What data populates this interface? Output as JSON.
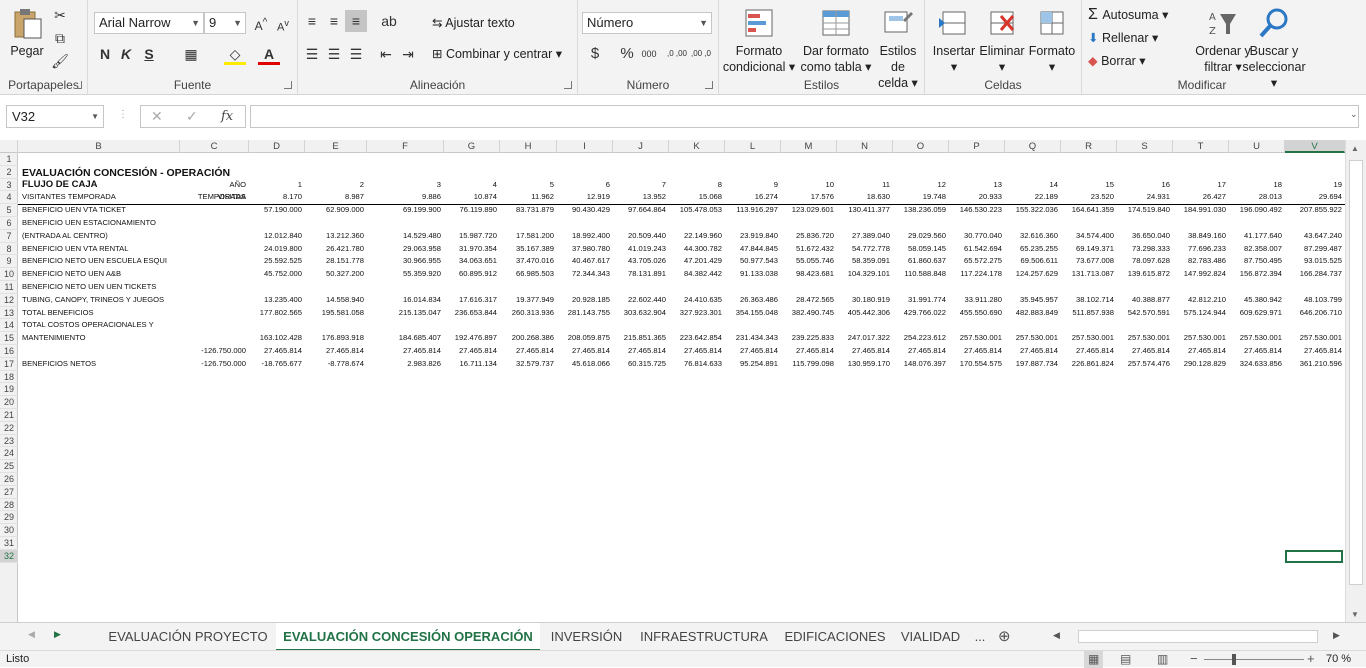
{
  "ribbon": {
    "portapapeles": {
      "label": "Portapapeles",
      "pegar": "Pegar"
    },
    "fuente": {
      "label": "Fuente",
      "font": "Arial Narrow",
      "size": "9",
      "bold": "N",
      "italic": "K",
      "underline": "S"
    },
    "alineacion": {
      "label": "Alineación",
      "wrap": "Ajustar texto",
      "merge": "Combinar y centrar"
    },
    "numero": {
      "label": "Número",
      "format": "Número",
      "currency": "$",
      "percent": "%",
      "thousands": "000",
      "dec_inc": ",0 ,00",
      "dec_dec": ",00 ,0"
    },
    "estilos": {
      "label": "Estilos",
      "cond_1": "Formato",
      "cond_2": "condicional",
      "table_1": "Dar formato",
      "table_2": "como tabla",
      "cell_1": "Estilos de",
      "cell_2": "celda"
    },
    "celdas": {
      "label": "Celdas",
      "insert": "Insertar",
      "delete": "Eliminar",
      "format": "Formato"
    },
    "modificar": {
      "label": "Modificar",
      "autosum": "Autosuma",
      "fill": "Rellenar",
      "clear": "Borrar",
      "sort_1": "Ordenar y",
      "sort_2": "filtrar",
      "find_1": "Buscar y",
      "find_2": "seleccionar"
    }
  },
  "formula_bar": {
    "name_box": "V32",
    "fx": "fx",
    "formula": ""
  },
  "columns": [
    "B",
    "C",
    "D",
    "E",
    "F",
    "G",
    "H",
    "I",
    "J",
    "K",
    "L",
    "M",
    "N",
    "O",
    "P",
    "Q",
    "R",
    "S",
    "T",
    "U",
    "V"
  ],
  "rows": [
    "1",
    "2",
    "3",
    "4",
    "5",
    "6",
    "7",
    "8",
    "9",
    "10",
    "11",
    "12",
    "13",
    "14",
    "15",
    "16",
    "17",
    "18",
    "19",
    "20",
    "21",
    "22",
    "23",
    "24",
    "25",
    "26",
    "27",
    "28",
    "29",
    "30",
    "31",
    "32"
  ],
  "sheet": {
    "title": "EVALUACIÓN CONCESIÓN - OPERACIÓN",
    "subtitle": "FLUJO DE CAJA",
    "c3": "AÑO",
    "years": [
      "1",
      "2",
      "3",
      "4",
      "5",
      "6",
      "7",
      "8",
      "9",
      "10",
      "11",
      "12",
      "13",
      "14",
      "15",
      "16",
      "17",
      "18",
      "19"
    ],
    "c_visitas_1": "VISITAS",
    "c_visitas_2": "TEMPORADA",
    "data_rows": [
      {
        "r": 4,
        "label": "VISITANTES TEMPORADA",
        "c": "",
        "values": [
          "8.170",
          "8.987",
          "9.886",
          "10.874",
          "11.962",
          "12.919",
          "13.952",
          "15.068",
          "16.274",
          "17.576",
          "18.630",
          "19.748",
          "20.933",
          "22.189",
          "23.520",
          "24.931",
          "26.427",
          "28.013",
          "29.694"
        ]
      },
      {
        "r": 5,
        "label": "BENEFICIO UEN VTA TICKET",
        "c": "",
        "values": [
          "57.190.000",
          "62.909.000",
          "69.199.900",
          "76.119.890",
          "83.731.879",
          "90.430.429",
          "97.664.864",
          "105.478.053",
          "113.916.297",
          "123.029.601",
          "130.411.377",
          "138.236.059",
          "146.530.223",
          "155.322.036",
          "164.641.359",
          "174.519.840",
          "184.991.030",
          "196.090.492",
          "207.855.922"
        ]
      },
      {
        "r": 6,
        "label": "BENEFICIO UEN ESTACIONAMIENTO",
        "c": "",
        "values": []
      },
      {
        "r": 7,
        "label": "(ENTRADA AL CENTRO)",
        "c": "",
        "values": [
          "12.012.840",
          "13.212.360",
          "14.529.480",
          "15.987.720",
          "17.581.200",
          "18.992.400",
          "20.509.440",
          "22.149.960",
          "23.919.840",
          "25.836.720",
          "27.389.040",
          "29.029.560",
          "30.770.040",
          "32.616.360",
          "34.574.400",
          "36.650.040",
          "38.849.160",
          "41.177.640",
          "43.647.240"
        ]
      },
      {
        "r": 8,
        "label": "BENEFICIO UEN VTA RENTAL",
        "c": "",
        "values": [
          "24.019.800",
          "26.421.780",
          "29.063.958",
          "31.970.354",
          "35.167.389",
          "37.980.780",
          "41.019.243",
          "44.300.782",
          "47.844.845",
          "51.672.432",
          "54.772.778",
          "58.059.145",
          "61.542.694",
          "65.235.255",
          "69.149.371",
          "73.298.333",
          "77.696.233",
          "82.358.007",
          "87.299.487"
        ]
      },
      {
        "r": 9,
        "label": "BENEFICIO NETO UEN ESCUELA ESQUI",
        "c": "",
        "values": [
          "25.592.525",
          "28.151.778",
          "30.966.955",
          "34.063.651",
          "37.470.016",
          "40.467.617",
          "43.705.026",
          "47.201.429",
          "50.977.543",
          "55.055.746",
          "58.359.091",
          "61.860.637",
          "65.572.275",
          "69.506.611",
          "73.677.008",
          "78.097.628",
          "82.783.486",
          "87.750.495",
          "93.015.525"
        ]
      },
      {
        "r": 10,
        "label": "BENEFICIO NETO UEN A&B",
        "c": "",
        "values": [
          "45.752.000",
          "50.327.200",
          "55.359.920",
          "60.895.912",
          "66.985.503",
          "72.344.343",
          "78.131.891",
          "84.382.442",
          "91.133.038",
          "98.423.681",
          "104.329.101",
          "110.588.848",
          "117.224.178",
          "124.257.629",
          "131.713.087",
          "139.615.872",
          "147.992.824",
          "156.872.394",
          "166.284.737"
        ]
      },
      {
        "r": 11,
        "label": "BENEFICIO NETO UEN UEN TICKETS",
        "c": "",
        "values": []
      },
      {
        "r": 12,
        "label": "TUBING, CANOPY, TRINEOS Y JUEGOS",
        "c": "",
        "values": [
          "13.235.400",
          "14.558.940",
          "16.014.834",
          "17.616.317",
          "19.377.949",
          "20.928.185",
          "22.602.440",
          "24.410.635",
          "26.363.486",
          "28.472.565",
          "30.180.919",
          "31.991.774",
          "33.911.280",
          "35.945.957",
          "38.102.714",
          "40.388.877",
          "42.812.210",
          "45.380.942",
          "48.103.799"
        ]
      },
      {
        "r": 13,
        "label": "TOTAL BENEFICIOS",
        "c": "",
        "values": [
          "177.802.565",
          "195.581.058",
          "215.135.047",
          "236.653.844",
          "260.313.936",
          "281.143.755",
          "303.632.904",
          "327.923.301",
          "354.155.048",
          "382.490.745",
          "405.442.306",
          "429.766.022",
          "455.550.690",
          "482.883.849",
          "511.857.938",
          "542.570.591",
          "575.124.944",
          "609.629.971",
          "646.206.710"
        ]
      },
      {
        "r": 15,
        "label": "TOTAL COSTOS OPERACIONALES Y",
        "c": "",
        "values": []
      },
      {
        "r": 16,
        "label": "MANTENIMIENTO",
        "c": "",
        "values": [
          "163.102.428",
          "176.893.918",
          "184.685.407",
          "192.476.897",
          "200.268.386",
          "208.059.875",
          "215.851.365",
          "223.642.854",
          "231.434.343",
          "239.225.833",
          "247.017.322",
          "254.223.612",
          "257.530.001",
          "257.530.001",
          "257.530.001",
          "257.530.001",
          "257.530.001",
          "257.530.001",
          "257.530.001"
        ]
      },
      {
        "r": 17,
        "label": "",
        "c": "-126.750.000",
        "values": [
          "27.465.814",
          "27.465.814",
          "27.465.814",
          "27.465.814",
          "27.465.814",
          "27.465.814",
          "27.465.814",
          "27.465.814",
          "27.465.814",
          "27.465.814",
          "27.465.814",
          "27.465.814",
          "27.465.814",
          "27.465.814",
          "27.465.814",
          "27.465.814",
          "27.465.814",
          "27.465.814",
          "27.465.814"
        ]
      },
      {
        "r": 18,
        "label": "BENEFICIOS NETOS",
        "c": "-126.750.000",
        "values": [
          "-18.765.677",
          "-8.778.674",
          "2.983.826",
          "16.711.134",
          "32.579.737",
          "45.618.066",
          "60.315.725",
          "76.814.633",
          "95.254.891",
          "115.799.098",
          "130.959.170",
          "148.076.397",
          "170.554.575",
          "197.887.734",
          "226.861.824",
          "257.574.476",
          "290.128.829",
          "324.633.856",
          "361.210.596"
        ]
      }
    ]
  },
  "tabs": [
    "EVALUACIÓN PROYECTO",
    "EVALUACIÓN CONCESIÓN OPERACIÓN",
    "INVERSIÓN",
    "INFRAESTRUCTURA",
    "EDIFICACIONES",
    "VIALIDAD",
    "..."
  ],
  "active_tab": "EVALUACIÓN CONCESIÓN OPERACIÓN",
  "status": {
    "left": "Listo",
    "zoom": "70 %"
  },
  "colors": {
    "accent": "#217346"
  }
}
